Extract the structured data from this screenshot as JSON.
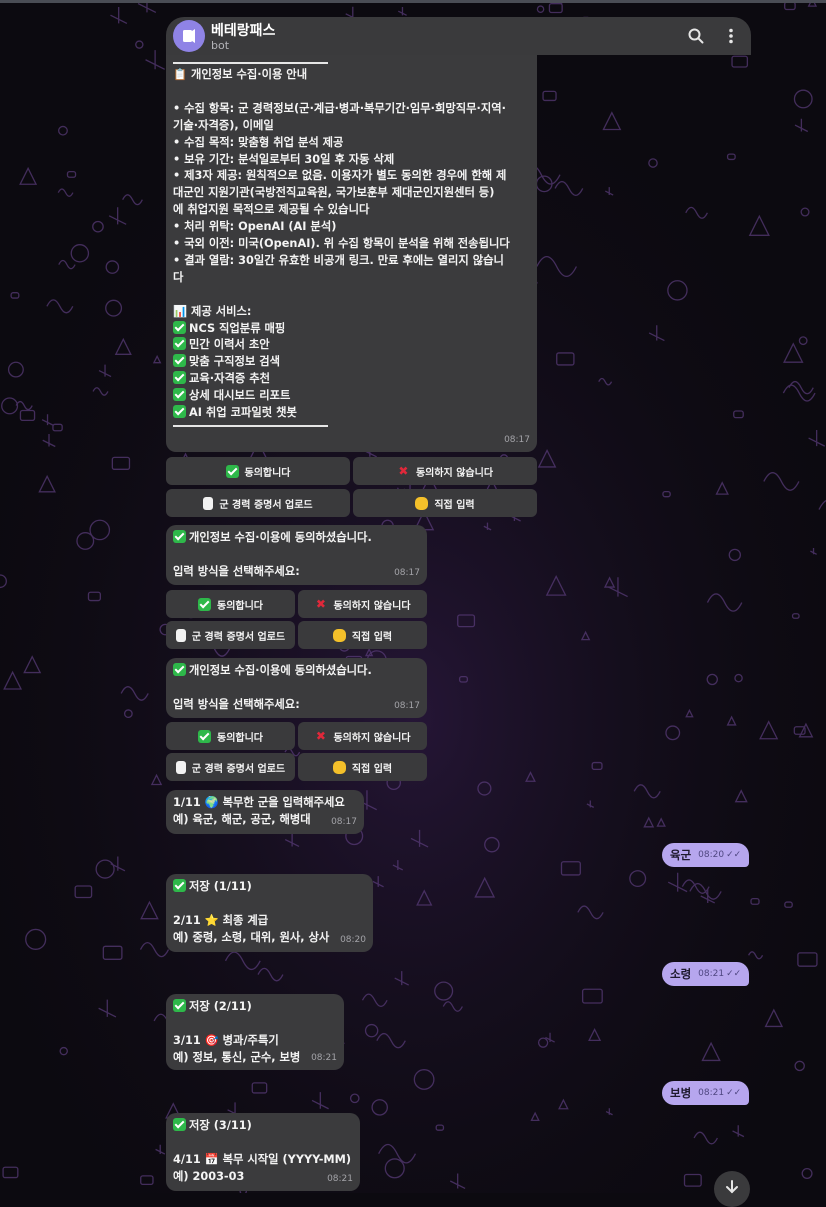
{
  "header": {
    "title": "베테랑패스",
    "subtitle": "bot"
  },
  "privacy": {
    "title": "📋 개인정보 수집·이용 안내",
    "lines": [
      "",
      "• 수집 항목: 군 경력정보(군·계급·병과·복무기간·임무·희망직무·지역·",
      "기술·자격증), 이메일",
      "• 수집 목적: 맞춤형 취업 분석 제공",
      "• 보유 기간: 분석일로부터 30일 후 자동 삭제",
      "• 제3자 제공: 원칙적으로 없음. 이용자가 별도 동의한 경우에 한해 제",
      "대군인 지원기관(국방전직교육원, 국가보훈부 제대군인지원센터 등)",
      "에 취업지원 목적으로 제공될 수 있습니다",
      "• 처리 위탁: OpenAI (AI 분석)",
      "• 국외 이전: 미국(OpenAI). 위 수집 항목이 분석을 위해 전송됩니다",
      "• 결과 열람: 30일간 유효한 비공개 링크. 만료 후에는 열리지 않습니",
      "다",
      ""
    ],
    "services_title": "📊 제공 서비스:",
    "services": [
      "NCS 직업분류 매핑",
      "민간 이력서 초안",
      "맞춤 구직정보 검색",
      "교육·자격증 추천",
      "상세 대시보드 리포트",
      "AI 취업 코파일럿 챗봇"
    ],
    "time": "08:17"
  },
  "keyboard": {
    "agree": "동의합니다",
    "disagree": "동의하지 않습니다",
    "upload": "군 경력 증명서 업로드",
    "manual": "직접 입력"
  },
  "consent_msg": {
    "line1": "개인정보 수집·이용에 동의하셨습니다.",
    "line2": "입력 방식을 선택해주세요:",
    "time": "08:17"
  },
  "q1": {
    "line1": "1/11 🌍 복무한 군을 입력해주세요",
    "line2": "예) 육군, 해군, 공군, 해병대",
    "time": "08:17"
  },
  "a1": {
    "text": "육군",
    "time": "08:20"
  },
  "q2": {
    "saved": "저장 (1/11)",
    "line1": "2/11 ⭐ 최종 계급",
    "line2": "예) 중령, 소령, 대위, 원사, 상사",
    "time": "08:20"
  },
  "a2": {
    "text": "소령",
    "time": "08:21"
  },
  "q3": {
    "saved": "저장 (2/11)",
    "line1": "3/11 🎯 병과/주특기",
    "line2": "예) 정보, 통신, 군수, 보병",
    "time": "08:21"
  },
  "a3": {
    "text": "보병",
    "time": "08:21"
  },
  "q4": {
    "saved": "저장 (3/11)",
    "line1": "4/11 📅 복무 시작일 (YYYY-MM)",
    "line2": "예) 2003-03",
    "time": "08:21"
  },
  "colors": {
    "background": "#0c0a10",
    "bubble_in": "#3b3b3d",
    "bubble_out": "#b6a6ee",
    "avatar": "#8f83e6"
  }
}
